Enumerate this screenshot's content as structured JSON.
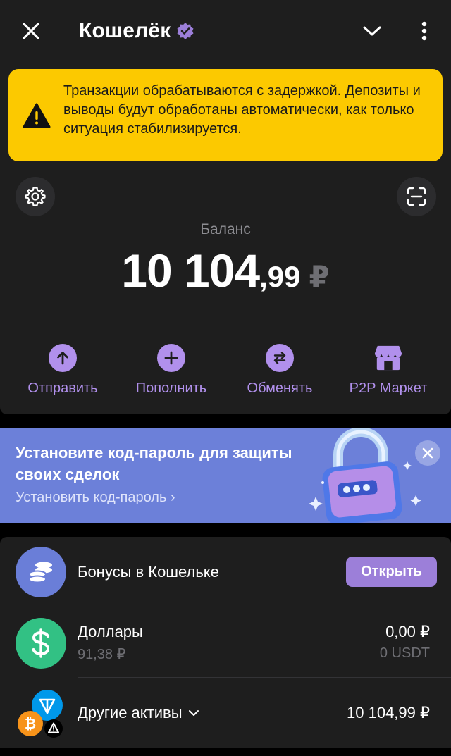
{
  "header": {
    "title": "Кошелёк",
    "verified_icon": "verified-badge-icon",
    "close_icon": "close-icon",
    "chevron_icon": "chevron-down-icon",
    "more_icon": "more-vertical-icon"
  },
  "warning": {
    "text": "Транзакции обрабатываются с задержкой. Депозиты и выводы будут обработаны автоматически, как только ситуация стабилизируется.",
    "icon": "warning-triangle-icon",
    "color": "#fcc900"
  },
  "balance": {
    "label": "Баланс",
    "integer": "10 104",
    "fraction": ",99",
    "currency": "₽"
  },
  "actions": [
    {
      "label": "Отправить",
      "icon": "arrow-up-icon"
    },
    {
      "label": "Пополнить",
      "icon": "plus-icon"
    },
    {
      "label": "Обменять",
      "icon": "swap-icon"
    },
    {
      "label": "P2P Маркет",
      "icon": "shop-icon"
    }
  ],
  "banner": {
    "title": "Установите код-пароль для защиты своих сделок",
    "link": "Установить код-пароль ›",
    "color": "#6c80d9"
  },
  "assets": {
    "bonus": {
      "title": "Бонусы в Кошельке",
      "button": "Открыть"
    },
    "dollars": {
      "title": "Доллары",
      "sub": "91,38 ₽",
      "amount": "0,00 ₽",
      "amount_sub": "0 USDT"
    },
    "other": {
      "title": "Другие активы",
      "amount": "10 104,99 ₽"
    }
  },
  "colors": {
    "accent": "#b190ec",
    "background": "#1e1e1e",
    "usdt_green": "#32c184",
    "bitcoin": "#f7931a",
    "ton": "#0098ea"
  }
}
